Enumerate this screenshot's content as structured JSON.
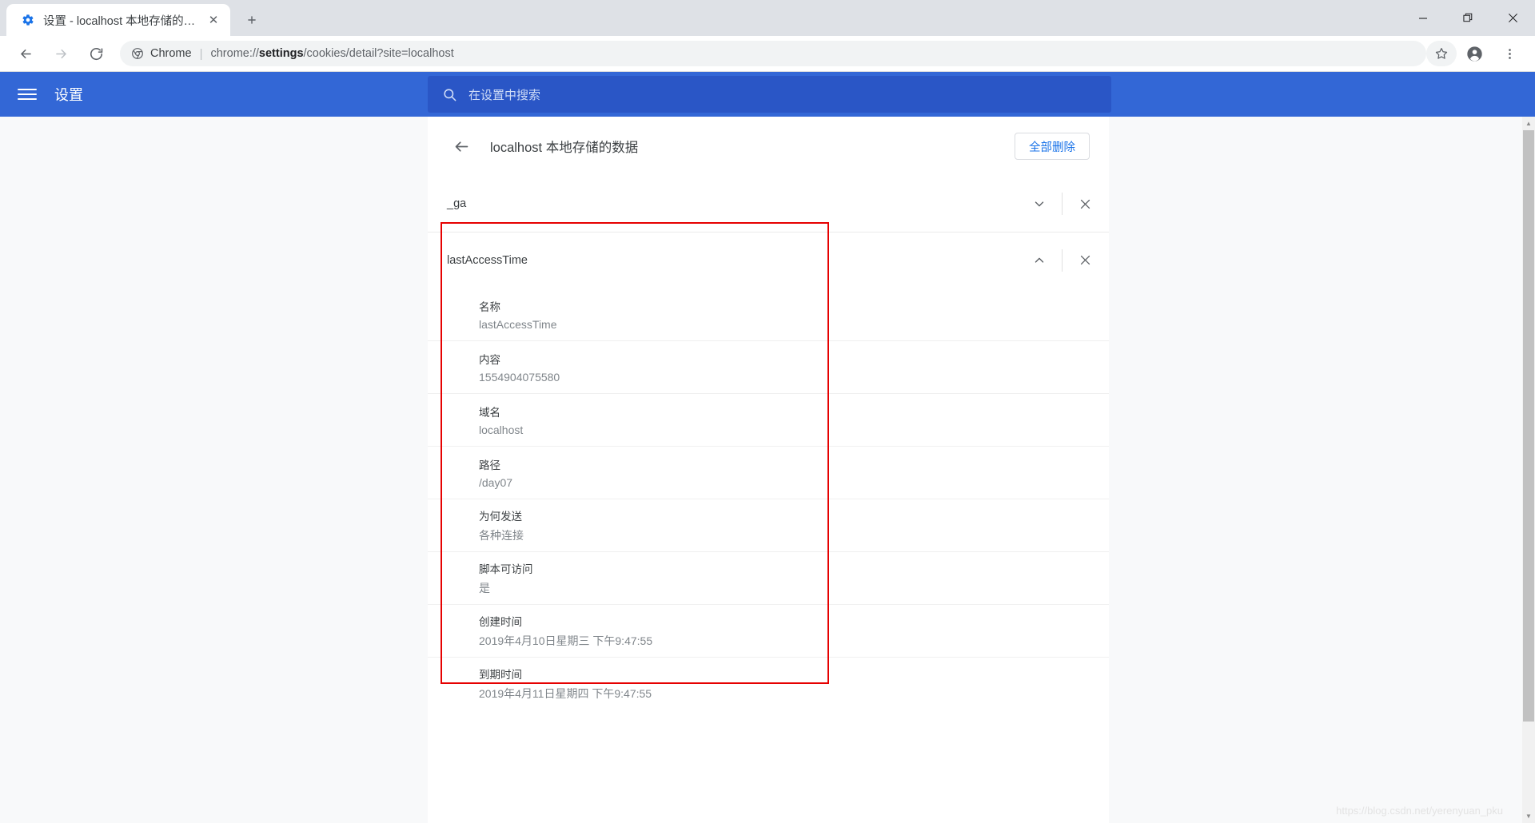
{
  "browser": {
    "tab": {
      "favicon": "gear-icon",
      "title": "设置 - localhost 本地存储的数据",
      "close_label": "✕"
    },
    "new_tab_label": "+",
    "window_controls": {
      "minimize": "—",
      "restore": "❐",
      "close": "✕"
    },
    "toolbar": {
      "back": "←",
      "forward": "→",
      "reload": "⟳",
      "omnibox_chip": "Chrome",
      "omnibox_separator": "|",
      "url_prefix": "chrome://",
      "url_bold": "settings",
      "url_suffix": "/cookies/detail?site=localhost",
      "bookmark_icon": "star-icon",
      "profile_icon": "avatar-icon",
      "menu_icon": "three-dot-menu-icon"
    }
  },
  "settings": {
    "menu_label": "hamburger-menu",
    "title": "设置",
    "search_placeholder": "在设置中搜索",
    "search_value": ""
  },
  "page": {
    "back_label": "←",
    "title": "localhost 本地存储的数据",
    "delete_all_label": "全部删除"
  },
  "cookies": [
    {
      "name": "_ga",
      "expanded": false,
      "toggle_icon": "chevron-down-icon",
      "remove_icon": "close-icon"
    },
    {
      "name": "lastAccessTime",
      "expanded": true,
      "toggle_icon": "chevron-up-icon",
      "remove_icon": "close-icon"
    }
  ],
  "details": [
    {
      "label": "名称",
      "value": "lastAccessTime"
    },
    {
      "label": "内容",
      "value": "1554904075580"
    },
    {
      "label": "域名",
      "value": "localhost"
    },
    {
      "label": "路径",
      "value": "/day07"
    },
    {
      "label": "为何发送",
      "value": "各种连接"
    },
    {
      "label": "脚本可访问",
      "value": "是"
    },
    {
      "label": "创建时间",
      "value": "2019年4月10日星期三 下午9:47:55"
    },
    {
      "label": "到期时间",
      "value": "2019年4月11日星期四 下午9:47:55"
    }
  ],
  "watermark": "https://blog.csdn.net/yerenyuan_pku",
  "colors": {
    "settings_header": "#3367d6",
    "search_field": "#2a56c6",
    "accent_link": "#1a73e8",
    "annotation_box": "#e60000",
    "tabstrip": "#dee1e6"
  }
}
